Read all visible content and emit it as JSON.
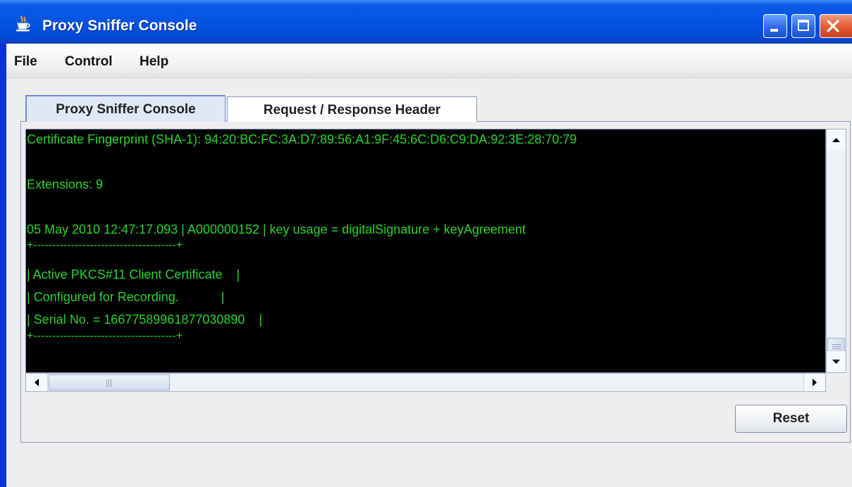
{
  "window": {
    "title": "Proxy Sniffer Console",
    "icon": "java-cup-icon",
    "controls": [
      "minimize-icon",
      "maximize-icon",
      "close-icon"
    ]
  },
  "menu": {
    "file": "File",
    "control": "Control",
    "help": "Help"
  },
  "tabs": [
    {
      "label": "Proxy Sniffer Console",
      "selected": true
    },
    {
      "label": "Request / Response Header",
      "selected": false
    }
  ],
  "console": {
    "text_color": "#27d32b",
    "background": "#000000",
    "lines": [
      "Certificate Fingerprint (SHA-1): 94:20:BC:FC:3A:D7:89:56:A1:9F:45:6C:D6:C9:DA:92:3E:28:70:79",
      "Extensions: 9",
      "05 May 2010 12:47:17.093 | A000000152 | key usage = digitalSignature + keyAgreement",
      "+--------------------------------------+",
      "| Active PKCS#11 Client Certificate    |",
      "| Configured for Recording.            |",
      "| Serial No. = 16677589961877030890    |",
      "+--------------------------------------+"
    ]
  },
  "buttons": {
    "reset": "Reset"
  },
  "colors": {
    "titlebar": "#0454e2",
    "close": "#e15a32",
    "console_text": "#27d32b"
  }
}
